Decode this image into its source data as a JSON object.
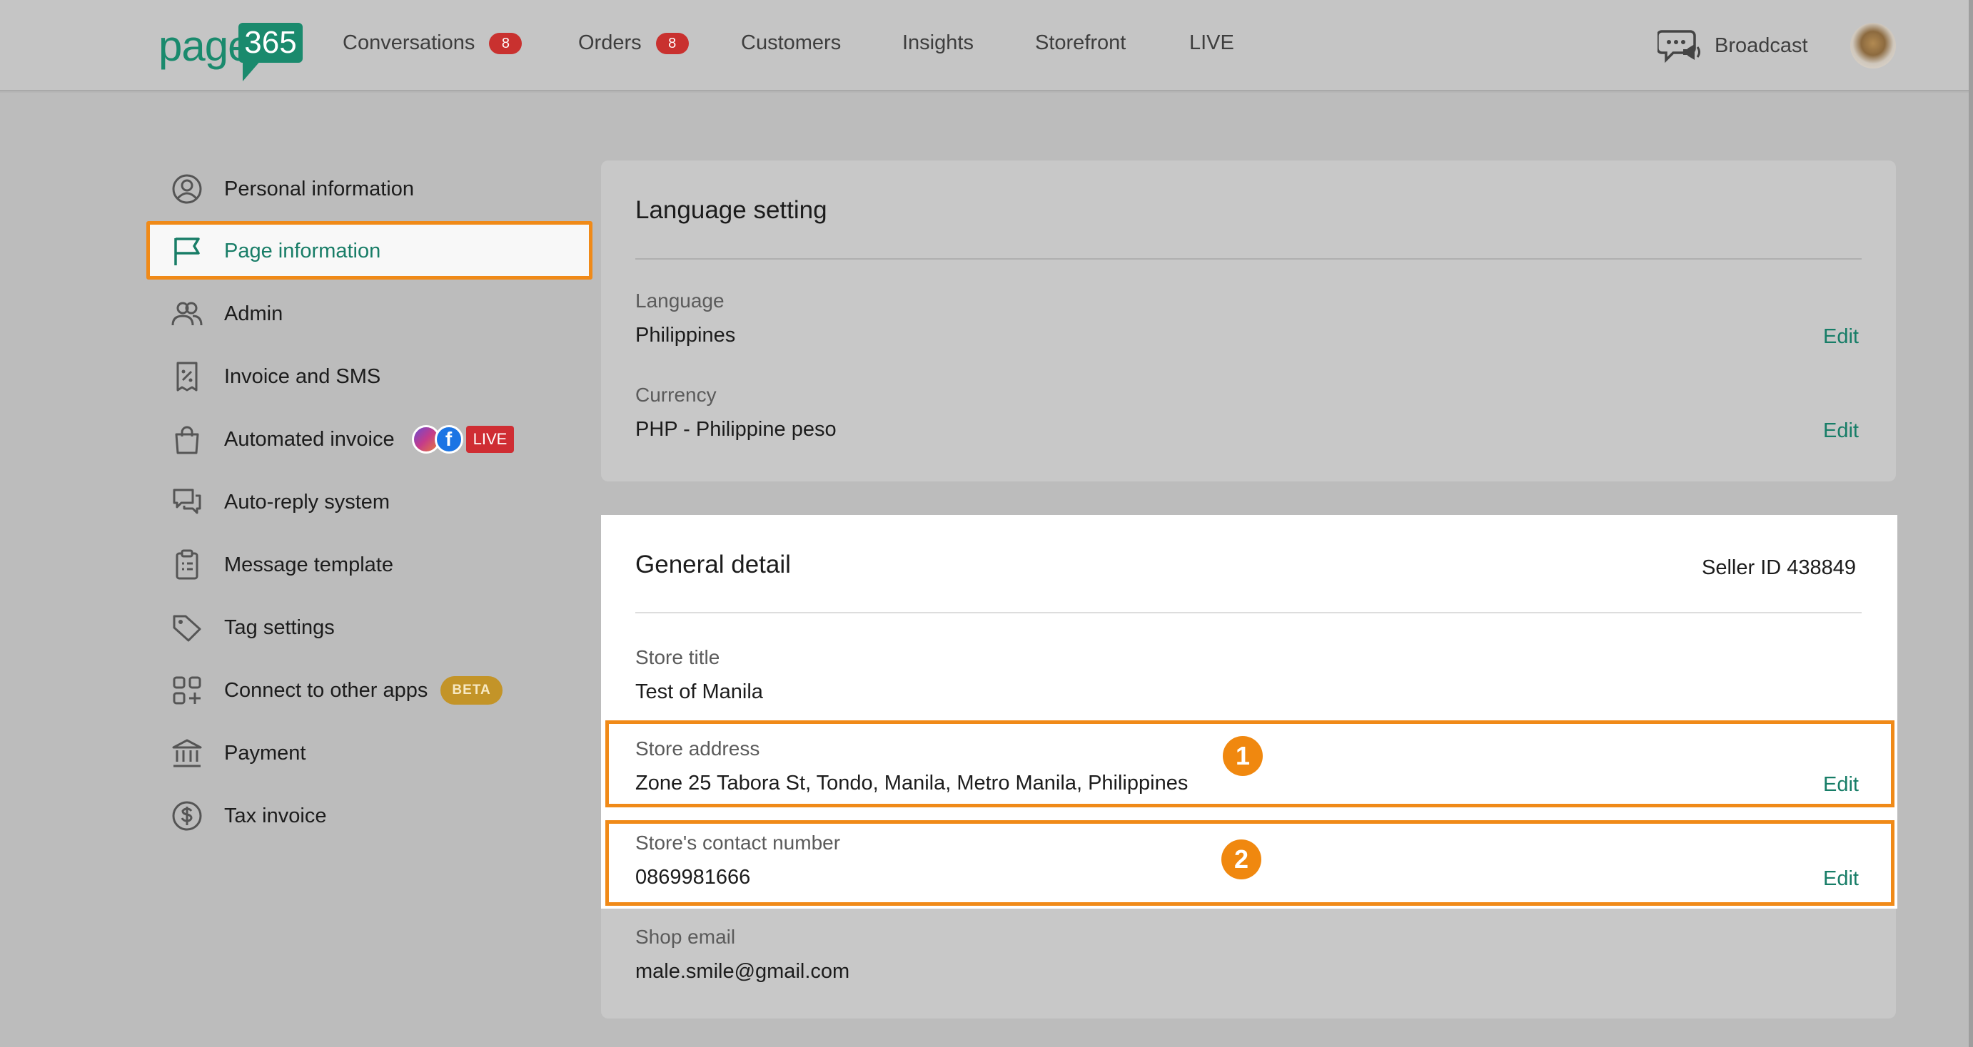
{
  "logo": {
    "left_text": "page",
    "box_text": "365"
  },
  "nav": {
    "conversations": {
      "label": "Conversations",
      "badge": "8"
    },
    "orders": {
      "label": "Orders",
      "badge": "8"
    },
    "customers": "Customers",
    "insights": "Insights",
    "storefront": "Storefront",
    "live": "LIVE",
    "broadcast": "Broadcast"
  },
  "sidebar": {
    "items": [
      {
        "label": "Personal information",
        "icon": "user-circle-icon"
      },
      {
        "label": "Page information",
        "icon": "flag-icon",
        "active": true
      },
      {
        "label": "Admin",
        "icon": "users-icon"
      },
      {
        "label": "Invoice and SMS",
        "icon": "receipt-percent-icon"
      },
      {
        "label": "Automated invoice",
        "icon": "shopping-bag-icon",
        "live_badge": "LIVE"
      },
      {
        "label": "Auto-reply system",
        "icon": "chat-bubbles-icon"
      },
      {
        "label": "Message template",
        "icon": "clipboard-icon"
      },
      {
        "label": "Tag settings",
        "icon": "tag-icon"
      },
      {
        "label": "Connect to other apps",
        "icon": "apps-grid-icon",
        "badge": "BETA"
      },
      {
        "label": "Payment",
        "icon": "bank-icon"
      },
      {
        "label": "Tax invoice",
        "icon": "dollar-circle-icon"
      }
    ]
  },
  "language_card": {
    "title": "Language setting",
    "language_label": "Language",
    "language_value": "Philippines",
    "currency_label": "Currency",
    "currency_value": "PHP - Philippine peso",
    "edit_label": "Edit"
  },
  "general_card": {
    "title": "General detail",
    "seller_id": "Seller ID 438849",
    "store_title_label": "Store title",
    "store_title_value": "Test of Manila",
    "address_label": "Store address",
    "address_value": "Zone 25 Tabora St, Tondo, Manila, Metro Manila, Philippines",
    "contact_label": "Store's contact number",
    "contact_value": "0869981666",
    "email_label": "Shop email",
    "email_value": "male.smile@gmail.com",
    "edit_label": "Edit"
  },
  "callouts": [
    "1",
    "2"
  ],
  "colors": {
    "accent": "#177d67",
    "highlight": "#f08a18",
    "badge": "#c9312f",
    "beta": "#c39428"
  }
}
